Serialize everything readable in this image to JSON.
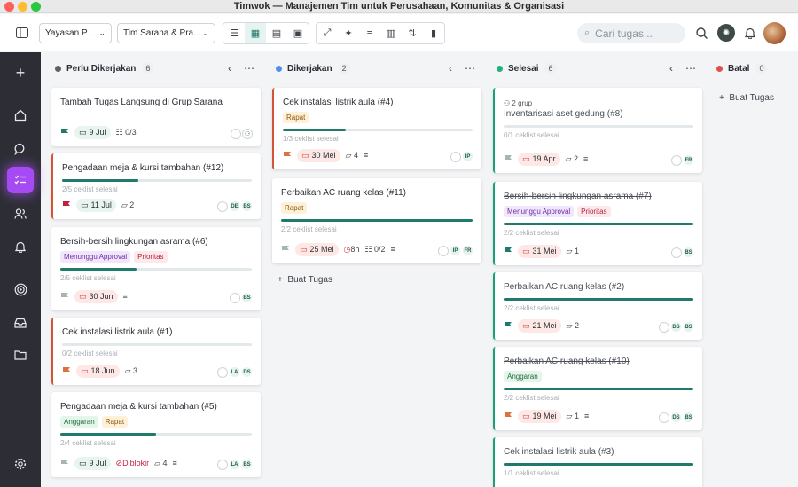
{
  "window": {
    "title": "Timwok — Manajemen Tim untuk Perusahaan, Komunitas & Organisasi"
  },
  "toolbar": {
    "org_select": "Yayasan P...",
    "group_select": "Tim Sarana & Pra...",
    "search_placeholder": "Cari tugas..."
  },
  "columns": [
    {
      "name": "Perlu Dikerjakan",
      "count": "6",
      "color": "#5b6168"
    },
    {
      "name": "Dikerjakan",
      "count": "2",
      "color": "#4f8ff0"
    },
    {
      "name": "Selesai",
      "count": "6",
      "color": "#22b07d"
    },
    {
      "name": "Batal",
      "count": "0",
      "color": "#e04e4e"
    }
  ],
  "add_task_label": "Buat Tugas",
  "col1": {
    "card0": {
      "title": "Tambah Tugas Langsung di Grup Sarana",
      "date": "9 Jul",
      "checklist": "0/3"
    },
    "card1": {
      "title": "Pengadaan meja & kursi tambahan (#12)",
      "progress": "2/5 ceklist selesai",
      "progress_value": 0.4,
      "date": "11 Jul",
      "comments": "2",
      "avatars": [
        "DE",
        "BS"
      ]
    },
    "card2": {
      "title": "Bersih-bersih lingkungan asrama (#6)",
      "tags": [
        "Menunggu Approval",
        "Prioritas"
      ],
      "progress": "2/5 ceklist selesai",
      "progress_value": 0.4,
      "date": "30 Jun",
      "avatars": [
        "BS"
      ]
    },
    "card3": {
      "title": "Cek instalasi listrik aula (#1)",
      "progress": "0/2 ceklist selesai",
      "progress_value": 0,
      "date": "18 Jun",
      "comments": "3",
      "avatars": [
        "LA",
        "DS"
      ]
    },
    "card4": {
      "title": "Pengadaan meja & kursi tambahan (#5)",
      "tags": [
        "Anggaran",
        "Rapat"
      ],
      "progress": "2/4 ceklist selesai",
      "progress_value": 0.5,
      "date": "9 Jul",
      "blocked": "Diblokir",
      "comments": "4",
      "avatars": [
        "LA",
        "BS"
      ]
    }
  },
  "col2": {
    "card0": {
      "title": "Cek instalasi listrik aula (#4)",
      "tags": [
        "Rapat"
      ],
      "progress": "1/3 ceklist selesai",
      "progress_value": 0.33,
      "date": "30 Mei",
      "comments": "4",
      "avatars": [
        "IP"
      ]
    },
    "card1": {
      "title": "Perbaikan AC ruang kelas (#11)",
      "tags": [
        "Rapat"
      ],
      "progress": "2/2 ceklist selesai",
      "progress_value": 1,
      "date": "25 Mei",
      "time": "8h",
      "checklist": "0/2",
      "avatars": [
        "IP",
        "FR"
      ]
    }
  },
  "col3": {
    "card0": {
      "group": "2 grup",
      "title": "Inventarisasi aset gedung (#8)",
      "progress": "0/1 ceklist selesai",
      "progress_value": 0,
      "date": "19 Apr",
      "comments": "2",
      "avatars": [
        "FR"
      ]
    },
    "card1": {
      "title": "Bersih-bersih lingkungan asrama (#7)",
      "tags": [
        "Menunggu Approval",
        "Prioritas"
      ],
      "progress": "2/2 ceklist selesai",
      "progress_value": 1,
      "date": "31 Mei",
      "comments": "1",
      "avatars": [
        "BS"
      ]
    },
    "card2": {
      "title": "Perbaikan AC ruang kelas (#2)",
      "progress": "2/2 ceklist selesai",
      "progress_value": 1,
      "date": "21 Mei",
      "comments": "2",
      "avatars": [
        "DS",
        "BS"
      ]
    },
    "card3": {
      "title": "Perbaikan AC ruang kelas (#10)",
      "tags": [
        "Anggaran"
      ],
      "progress": "2/2 ceklist selesai",
      "progress_value": 1,
      "date": "19 Mei",
      "comments": "1",
      "avatars": [
        "DS",
        "BS"
      ]
    },
    "card4": {
      "title": "Cek instalasi listrik aula (#3)",
      "progress": "1/1 ceklist selesai",
      "progress_value": 1
    }
  },
  "colors": {
    "accent": "#1f7a6b",
    "sidebar": "#2d2e35",
    "active": "#a64bf4",
    "overdue": "#fde8e6"
  }
}
